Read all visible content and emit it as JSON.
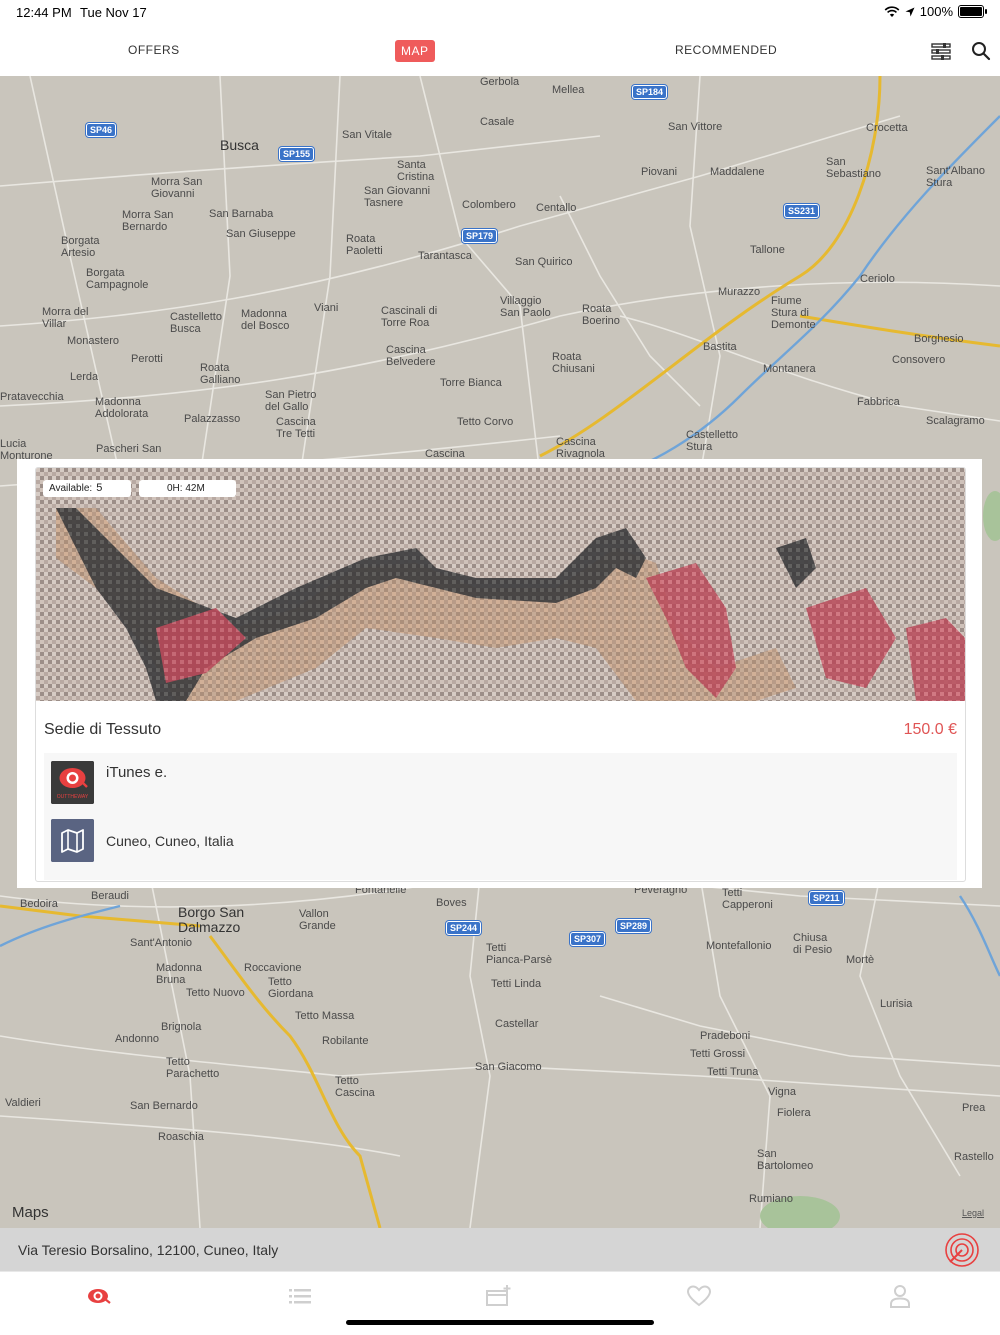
{
  "status_bar": {
    "time": "12:44 PM",
    "date": "Tue Nov 17",
    "battery": "100%"
  },
  "top_nav": {
    "tabs": [
      {
        "label": "OFFERS",
        "active": false
      },
      {
        "label": "MAP",
        "active": true
      },
      {
        "label": "RECOMMENDED",
        "active": false
      }
    ],
    "icons": [
      "filter-sliders-icon",
      "search-icon"
    ],
    "accent": "#ef5b5b"
  },
  "map": {
    "attribution": "Maps",
    "legal": "Legal",
    "places": [
      {
        "name": "Gerbola"
      },
      {
        "name": "Mellea"
      },
      {
        "name": "Casale"
      },
      {
        "name": "San Vittore"
      },
      {
        "name": "Crocetta"
      },
      {
        "name": "Busca",
        "big": true
      },
      {
        "name": "San Vitale"
      },
      {
        "name": "Santa\nCristina"
      },
      {
        "name": "San Giovanni\nTasnere"
      },
      {
        "name": "Morra San\nGiovanni"
      },
      {
        "name": "Maddalene"
      },
      {
        "name": "Piovani"
      },
      {
        "name": "San\nSebastiano"
      },
      {
        "name": "Sant'Albano\nStura"
      },
      {
        "name": "Morra San\nBernardo"
      },
      {
        "name": "San Barnaba"
      },
      {
        "name": "San Giuseppe"
      },
      {
        "name": "Colombero"
      },
      {
        "name": "Centallo"
      },
      {
        "name": "Borgata\nArtesio"
      },
      {
        "name": "Roata\nPaoletti"
      },
      {
        "name": "Tarantasca"
      },
      {
        "name": "San Quirico"
      },
      {
        "name": "Tallone"
      },
      {
        "name": "Borgata\nCampagnole"
      },
      {
        "name": "Ceriolo"
      },
      {
        "name": "Murazzo"
      },
      {
        "name": "Villaggio\nSan Paolo"
      },
      {
        "name": "Roata\nBoerino"
      },
      {
        "name": "Morra del\nVillar"
      },
      {
        "name": "Castelletto\nBusca"
      },
      {
        "name": "Madonna\ndel Bosco"
      },
      {
        "name": "Viani"
      },
      {
        "name": "Cascinali di\nTorre Roa"
      },
      {
        "name": "Fiume\nStura di\nDemonte"
      },
      {
        "name": "Borghesio"
      },
      {
        "name": "Monastero"
      },
      {
        "name": "Bastita"
      },
      {
        "name": "Consovero"
      },
      {
        "name": "Cascina\nBelvedere"
      },
      {
        "name": "Perotti"
      },
      {
        "name": "Roata\nChiusani"
      },
      {
        "name": "Montanera"
      },
      {
        "name": "Roata\nGalliano"
      },
      {
        "name": "Lerda"
      },
      {
        "name": "Torre Bianca"
      },
      {
        "name": "Pratavecchia"
      },
      {
        "name": "Madonna\nAddolorata"
      },
      {
        "name": "San Pietro\ndel Gallo"
      },
      {
        "name": "Fabbrica"
      },
      {
        "name": "Palazzasso"
      },
      {
        "name": "Scalagramo"
      },
      {
        "name": "Tetto Corvo"
      },
      {
        "name": "Cascina\nTre Tetti"
      },
      {
        "name": "Castelletto\nStura"
      },
      {
        "name": "Lucia\nMonturone"
      },
      {
        "name": "Pascheri San"
      },
      {
        "name": "Cascina"
      },
      {
        "name": "Cascina\nRivagnola"
      },
      {
        "name": "Fontanelle"
      },
      {
        "name": "Peveragno"
      },
      {
        "name": "Tetti\nCapperoni"
      },
      {
        "name": "Bedoira"
      },
      {
        "name": "Beraudi"
      },
      {
        "name": "Boves"
      },
      {
        "name": "Borgo San\nDalmazzo",
        "big": true
      },
      {
        "name": "Vallon\nGrande"
      },
      {
        "name": "Chiusa\ndi Pesio"
      },
      {
        "name": "Sant'Antonio"
      },
      {
        "name": "Tetti\nPianca-Parsè"
      },
      {
        "name": "Montefallonio"
      },
      {
        "name": "Mortè"
      },
      {
        "name": "Madonna\nBruna"
      },
      {
        "name": "Roccavione"
      },
      {
        "name": "Tetto\nGiordana"
      },
      {
        "name": "Tetto Nuovo"
      },
      {
        "name": "Tetti Linda"
      },
      {
        "name": "Lurisia"
      },
      {
        "name": "Tetto Massa"
      },
      {
        "name": "Brignola"
      },
      {
        "name": "Castellar"
      },
      {
        "name": "Andonno"
      },
      {
        "name": "Robilante"
      },
      {
        "name": "Pradeboni"
      },
      {
        "name": "Tetti Grossi"
      },
      {
        "name": "Tetto\nParachetto"
      },
      {
        "name": "San Giacomo"
      },
      {
        "name": "Tetti Truna"
      },
      {
        "name": "Tetto\nCascina"
      },
      {
        "name": "Vigna"
      },
      {
        "name": "Valdieri"
      },
      {
        "name": "San Bernardo"
      },
      {
        "name": "Prea"
      },
      {
        "name": "Fiolera"
      },
      {
        "name": "Roaschia"
      },
      {
        "name": "San\nBartolomeo"
      },
      {
        "name": "Rastello"
      },
      {
        "name": "Rumiano"
      }
    ],
    "road_shields": [
      "SP46",
      "SP155",
      "SP184",
      "SS231",
      "SP179",
      "SP211",
      "SP244",
      "SP289",
      "SP307"
    ]
  },
  "offer_card": {
    "available_label": "Available:",
    "available_count": "5",
    "time_left": "0H: 42M",
    "title": "Sedie di Tessuto",
    "price": "150.0 €",
    "seller": "iTunes e.",
    "seller_logo_text": "OUTTHEWAY",
    "location": "Cuneo, Cuneo, Italia",
    "price_color": "#e05555"
  },
  "address_bar": {
    "address": "Via Teresio Borsalino, 12100, Cuneo, Italy"
  },
  "tab_bar": {
    "items": [
      "eye-icon",
      "list-icon",
      "new-card-icon",
      "heart-icon",
      "profile-icon"
    ],
    "active_index": 0
  }
}
